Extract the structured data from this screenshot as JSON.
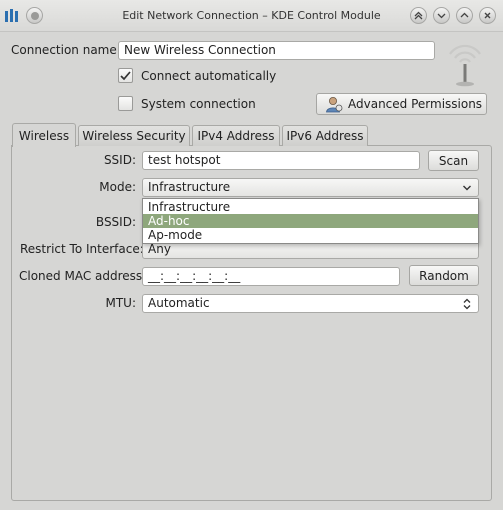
{
  "window": {
    "title": "Edit Network Connection – KDE Control Module"
  },
  "connection": {
    "name_label": "Connection name:",
    "name_value": "New Wireless Connection",
    "auto_label": "Connect automatically",
    "auto_checked": true,
    "system_label": "System connection",
    "system_checked": false,
    "advanced_button": "Advanced Permissions"
  },
  "tabs": [
    {
      "label": "Wireless",
      "active": true
    },
    {
      "label": "Wireless Security",
      "active": false
    },
    {
      "label": "IPv4 Address",
      "active": false
    },
    {
      "label": "IPv6 Address",
      "active": false
    }
  ],
  "wireless": {
    "ssid_label": "SSID:",
    "ssid_value": "test hotspot",
    "scan_button": "Scan",
    "mode_label": "Mode:",
    "mode_value": "Infrastructure",
    "mode_options": [
      "Infrastructure",
      "Ad-hoc",
      "Ap-mode"
    ],
    "mode_highlighted": "Ad-hoc",
    "bssid_label": "BSSID:",
    "restrict_label": "Restrict To Interface:",
    "restrict_value": "Any",
    "cloned_mac_label": "Cloned MAC address",
    "cloned_mac_value": "__:__:__:__:__:__",
    "random_button": "Random",
    "mtu_label": "MTU:",
    "mtu_value": "Automatic"
  }
}
